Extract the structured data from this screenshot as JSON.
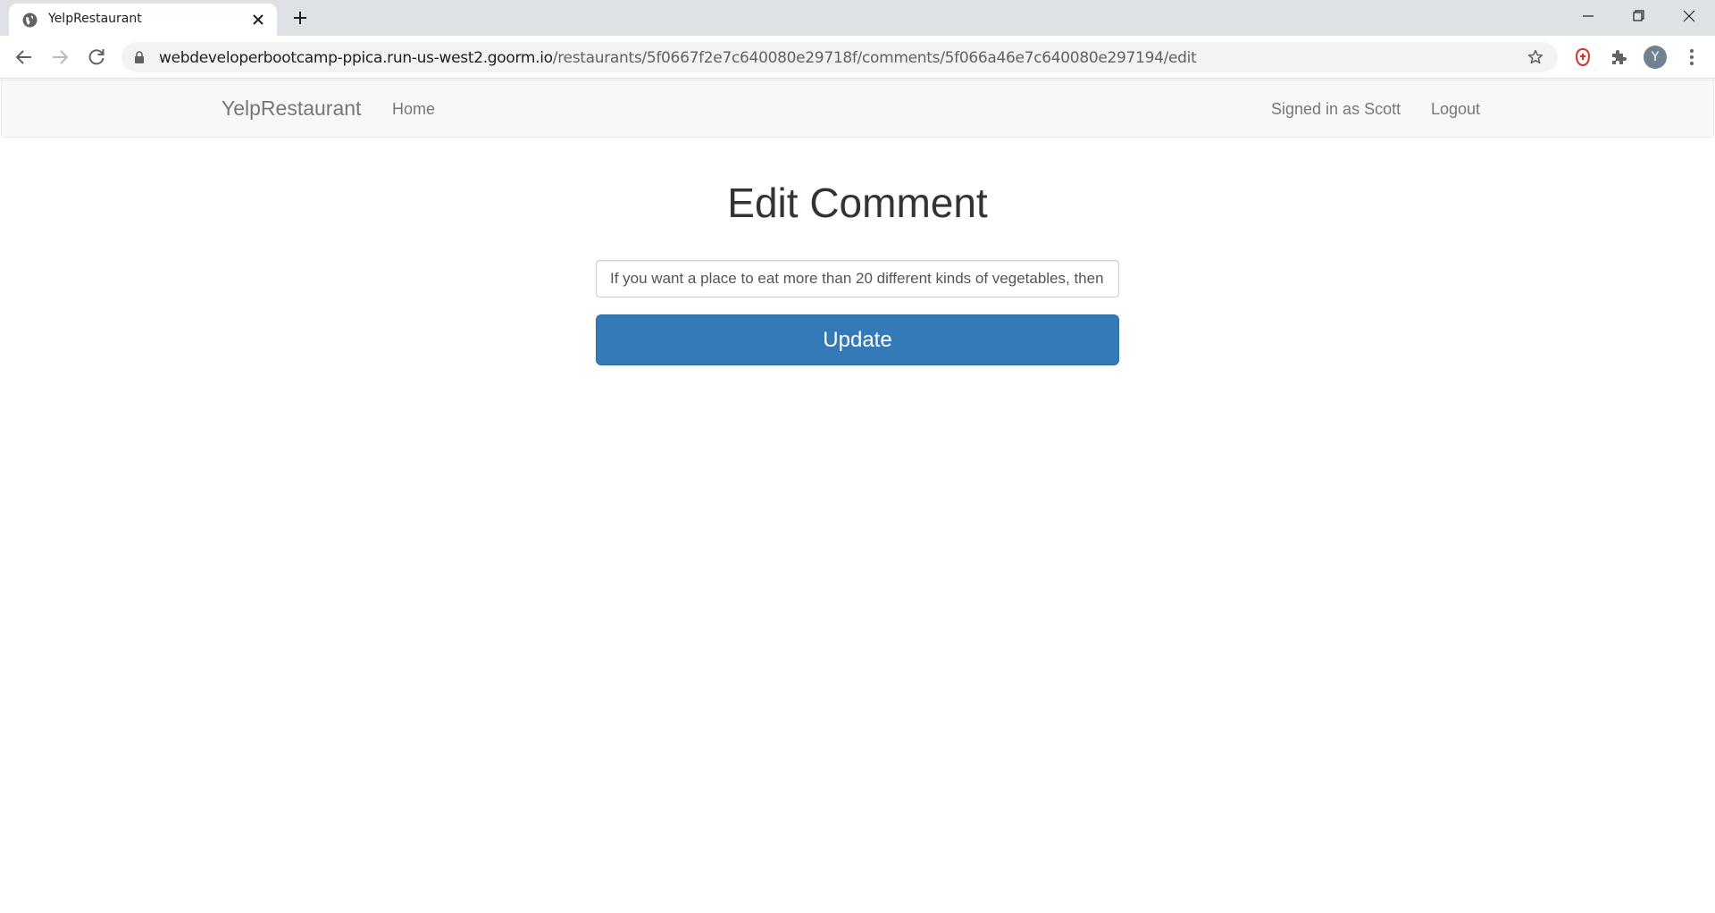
{
  "browser": {
    "tab": {
      "title": "YelpRestaurant",
      "favicon": "globe-icon"
    },
    "address_bar": {
      "host": "webdeveloperbootcamp-ppica.run-us-west2.goorm.io",
      "path": "/restaurants/5f0667f2e7c640080e29718f/comments/5f066a46e7c640080e297194/edit"
    },
    "profile_initial": "Y",
    "icons": {
      "back": "arrow-left-icon",
      "forward": "arrow-right-icon",
      "reload": "reload-icon",
      "lock": "lock-icon",
      "bookmark": "star-icon",
      "extension_red": "adblock-extension-icon",
      "extensions": "puzzle-icon",
      "menu": "kebab-menu-icon"
    }
  },
  "navbar": {
    "brand": "YelpRestaurant",
    "home": "Home",
    "signed_in": "Signed in as Scott",
    "logout": "Logout"
  },
  "form": {
    "title": "Edit Comment",
    "comment_value": "If you want a place to eat more than 20 different kinds of vegetables, then",
    "submit_label": "Update"
  },
  "colors": {
    "primary_button": "#337ab7",
    "navbar_bg": "#f8f8f8",
    "link_color": "#777777",
    "extension_red": "#d93025"
  }
}
